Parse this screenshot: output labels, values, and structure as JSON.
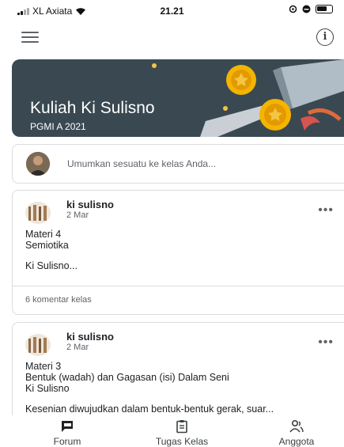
{
  "status_bar": {
    "carrier": "XL Axiata",
    "time": "21.21"
  },
  "class": {
    "title": "Kuliah Ki Sulisno",
    "section": "PGMI A 2021"
  },
  "announce": {
    "placeholder": "Umumkan sesuatu ke kelas Anda..."
  },
  "posts": [
    {
      "author": "ki sulisno",
      "date": "2 Mar",
      "line1": "Materi 4",
      "line2": "Semiotika",
      "line3": "Ki Sulisno...",
      "comments": "6 komentar kelas"
    },
    {
      "author": "ki sulisno",
      "date": "2 Mar",
      "line1": "Materi 3",
      "line2": "Bentuk (wadah) dan Gagasan (isi) Dalam Seni",
      "line3": "Ki Sulisno",
      "line4": "Kesenian diwujudkan dalam bentuk-bentuk gerak, suar..."
    }
  ],
  "nav": {
    "forum": "Forum",
    "tugas": "Tugas Kelas",
    "anggota": "Anggota"
  },
  "colors": {
    "banner": "#3a4951",
    "active_nav": "#202124"
  }
}
